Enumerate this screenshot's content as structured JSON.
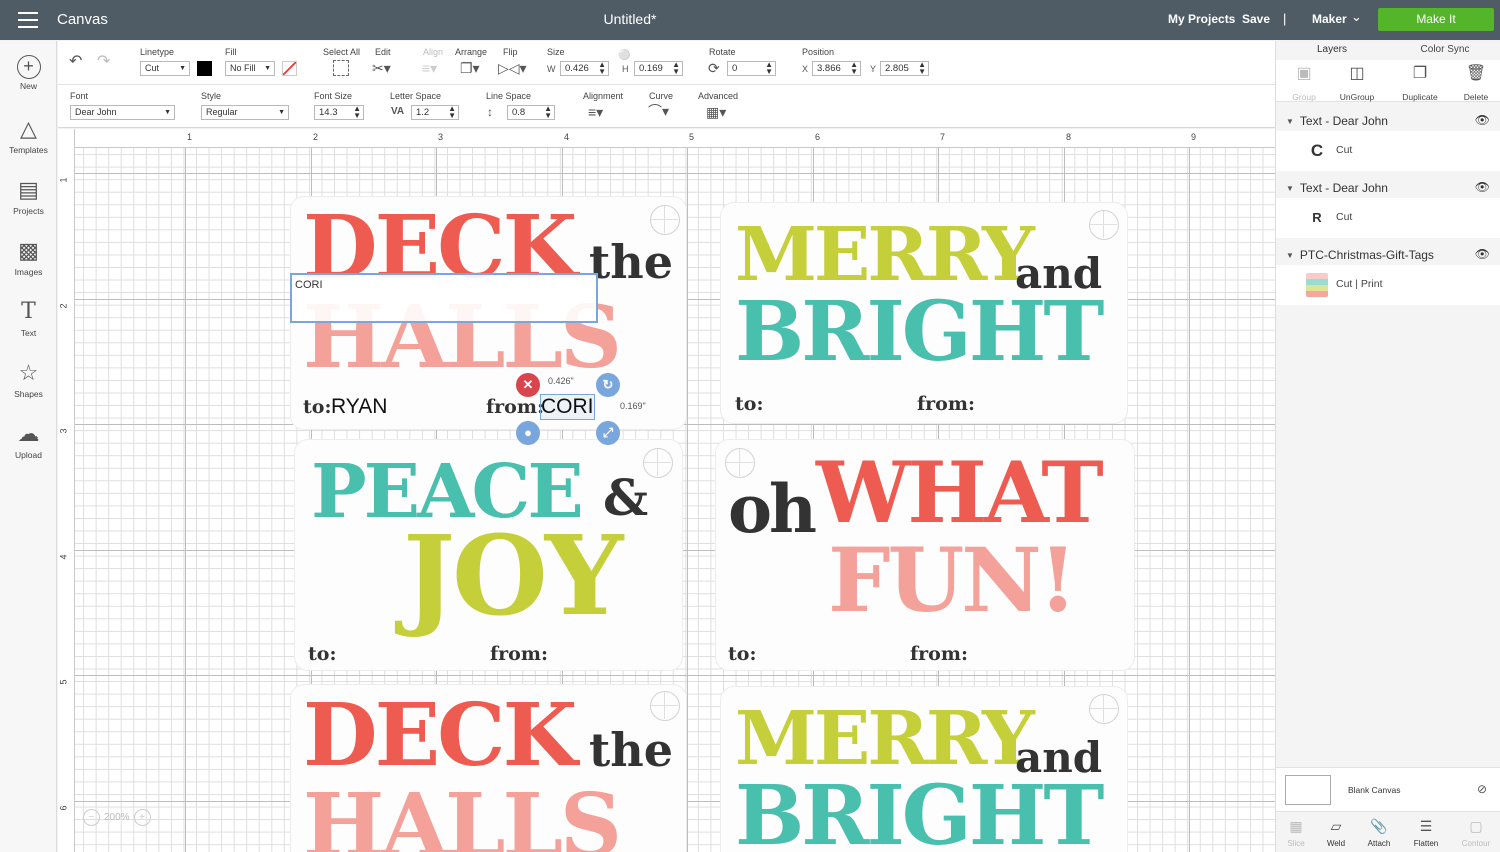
{
  "topbar": {
    "app_name": "Canvas",
    "doc_title": "Untitled*",
    "my_projects": "My Projects",
    "save": "Save",
    "separator": "|",
    "machine": "Maker",
    "make_it": "Make It",
    "make_it_color": "#55b52a"
  },
  "toolbar1": {
    "linetype_label": "Linetype",
    "linetype_value": "Cut",
    "fill_label": "Fill",
    "fill_value": "No Fill",
    "fill_swatch_color": "#000000",
    "select_all_label": "Select All",
    "edit_label": "Edit",
    "align_label": "Align",
    "arrange_label": "Arrange",
    "flip_label": "Flip",
    "size_label": "Size",
    "w_label": "W",
    "w_value": "0.426",
    "h_label": "H",
    "h_value": "0.169",
    "rotate_label": "Rotate",
    "rotate_value": "0",
    "position_label": "Position",
    "x_label": "X",
    "x_value": "3.866",
    "y_label": "Y",
    "y_value": "2.805"
  },
  "toolbar2": {
    "font_label": "Font",
    "font_value": "Dear John",
    "style_label": "Style",
    "style_value": "Regular",
    "font_size_label": "Font Size",
    "font_size_value": "14.3",
    "letter_space_label": "Letter Space",
    "letter_space_value": "1.2",
    "line_space_label": "Line Space",
    "line_space_value": "0.8",
    "alignment_label": "Alignment",
    "curve_label": "Curve",
    "advanced_label": "Advanced"
  },
  "leftbar": {
    "items": [
      {
        "label": "New",
        "icon": "plus-circle-icon"
      },
      {
        "label": "Templates",
        "icon": "tshirt-icon"
      },
      {
        "label": "Projects",
        "icon": "projects-icon"
      },
      {
        "label": "Images",
        "icon": "image-icon"
      },
      {
        "label": "Text",
        "icon": "text-icon"
      },
      {
        "label": "Shapes",
        "icon": "shapes-icon"
      },
      {
        "label": "Upload",
        "icon": "upload-cloud-icon"
      }
    ]
  },
  "ruler": {
    "top": [
      "1",
      "2",
      "3",
      "4",
      "5",
      "6",
      "7",
      "8",
      "9"
    ],
    "left": [
      "1",
      "2",
      "3",
      "4",
      "5",
      "6"
    ]
  },
  "canvas": {
    "zoom": "200%",
    "tags": {
      "deck1_big1": "DECK",
      "deck1_the": "the",
      "deck1_big2": "HALLS",
      "deck1_to": "to:",
      "deck1_to_name": "RYAN",
      "deck1_from": "from:",
      "deck1_from_name": "CORI",
      "merry1_big1": "MERRY",
      "merry1_and": "and",
      "merry1_big2": "BRIGHT",
      "merry1_to": "to:",
      "merry1_from": "from:",
      "peace_big1": "PEACE",
      "peace_amp": "&",
      "peace_big2": "JOY",
      "peace_to": "to:",
      "peace_from": "from:",
      "oh_small": "oh",
      "oh_big1": "WHAT",
      "oh_big2": "FUN!",
      "oh_to": "to:",
      "oh_from": "from:",
      "deck2_big1": "DECK",
      "deck2_the": "the",
      "deck2_big2": "HALLS",
      "merry2_big1": "MERRY",
      "merry2_and": "and",
      "merry2_big2": "BRIGHT"
    },
    "edit_box_text": "CORI",
    "dim_w": "0.426\"",
    "dim_h": "0.169\""
  },
  "colors": {
    "red": "#ee5b50",
    "teal": "#49bfae",
    "lime": "#c4cf3a",
    "pink": "#f4a19a",
    "selection_blue": "#7aa6de",
    "delete_red": "#d9444d"
  },
  "layers_panel": {
    "tab_layers": "Layers",
    "tab_color_sync": "Color Sync",
    "actions": [
      {
        "label": "Group",
        "enabled": false
      },
      {
        "label": "UnGroup",
        "enabled": true
      },
      {
        "label": "Duplicate",
        "enabled": true
      },
      {
        "label": "Delete",
        "enabled": true
      }
    ],
    "groups": [
      {
        "title": "Text - Dear John",
        "thumb": "C",
        "operation": "Cut"
      },
      {
        "title": "Text - Dear John",
        "thumb": "R",
        "operation": "Cut"
      },
      {
        "title": "PTC-Christmas-Gift-Tags",
        "thumb": "",
        "operation": "Cut  |  Print"
      }
    ],
    "blank_canvas": "Blank Canvas",
    "bottom": [
      {
        "label": "Slice",
        "enabled": false
      },
      {
        "label": "Weld",
        "enabled": true
      },
      {
        "label": "Attach",
        "enabled": true
      },
      {
        "label": "Flatten",
        "enabled": true
      },
      {
        "label": "Contour",
        "enabled": false
      }
    ]
  }
}
